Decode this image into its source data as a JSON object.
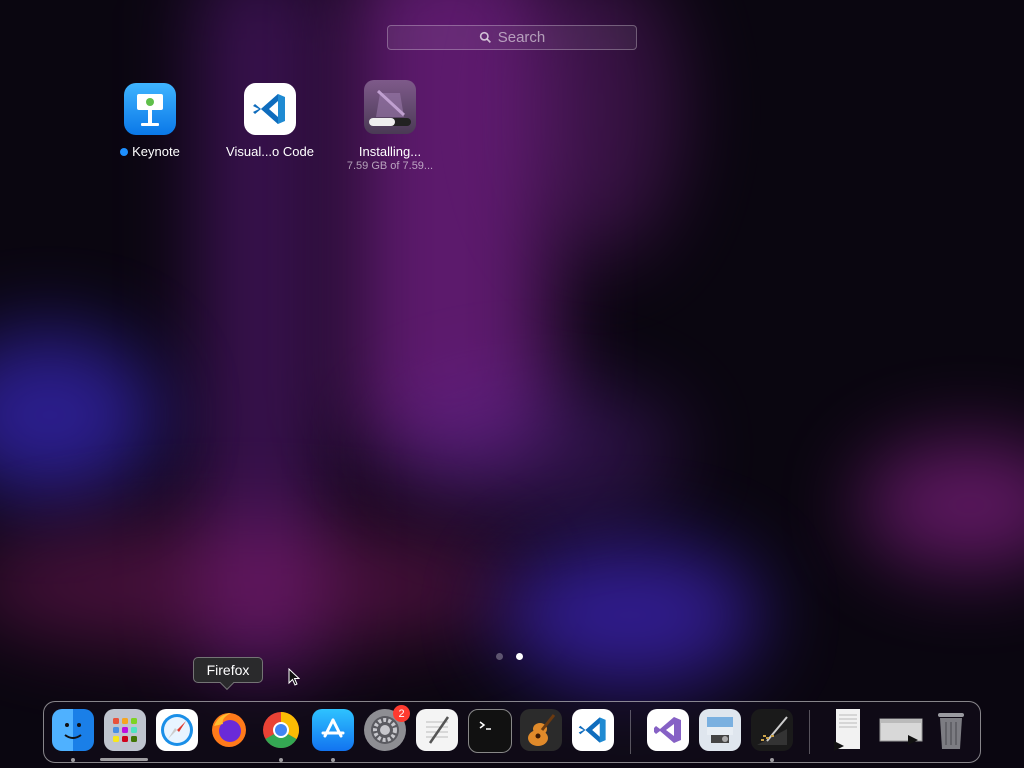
{
  "search": {
    "placeholder": "Search",
    "icon": "magnifier-icon"
  },
  "apps": [
    {
      "name": "Keynote",
      "new_indicator": true
    },
    {
      "name": "Visual...o Code"
    },
    {
      "name": "Installing...",
      "status": "7.59 GB of 7.59..."
    }
  ],
  "page_indicator": {
    "pages": 2,
    "current": 2
  },
  "tooltip": {
    "text": "Firefox"
  },
  "dock": {
    "items": [
      "Finder",
      "Launchpad",
      "Safari",
      "Firefox",
      "Google Chrome",
      "App Store",
      "System Settings",
      "TextEdit",
      "Terminal",
      "GarageBand",
      "Visual Studio Code",
      "Visual Studio",
      "Preview",
      "Script Editor",
      "Document",
      "Screenshot",
      "Trash"
    ],
    "system_settings_badge": "2"
  },
  "colors": {
    "accent": "#1e90ff",
    "badge": "#ff3b30",
    "bg": "#0a0610"
  }
}
